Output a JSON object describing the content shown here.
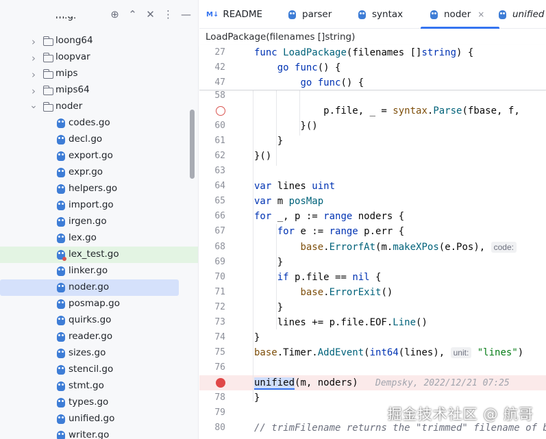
{
  "tree_toolbar": {
    "icons": [
      "crosshair-icon",
      "expand-icon",
      "collapse-icon",
      "more-vertical-icon",
      "hide-icon"
    ],
    "glyphs": [
      "⊕",
      "⌃",
      "✕",
      "⋮",
      "—"
    ]
  },
  "tree": {
    "truncated_top_label": "m.g.",
    "folders": [
      {
        "label": "loong64",
        "expanded": false
      },
      {
        "label": "loopvar",
        "expanded": false
      },
      {
        "label": "mips",
        "expanded": false
      },
      {
        "label": "mips64",
        "expanded": false
      },
      {
        "label": "noder",
        "expanded": true
      }
    ],
    "files": [
      {
        "label": "codes.go"
      },
      {
        "label": "decl.go"
      },
      {
        "label": "export.go"
      },
      {
        "label": "expr.go"
      },
      {
        "label": "helpers.go"
      },
      {
        "label": "import.go"
      },
      {
        "label": "irgen.go"
      },
      {
        "label": "lex.go"
      },
      {
        "label": "lex_test.go",
        "status": "added-green"
      },
      {
        "label": "linker.go"
      },
      {
        "label": "noder.go",
        "status": "selected"
      },
      {
        "label": "posmap.go"
      },
      {
        "label": "quirks.go"
      },
      {
        "label": "reader.go"
      },
      {
        "label": "sizes.go"
      },
      {
        "label": "stencil.go"
      },
      {
        "label": "stmt.go"
      },
      {
        "label": "types.go"
      },
      {
        "label": "unified.go"
      },
      {
        "label": "writer.go"
      }
    ]
  },
  "tabs": [
    {
      "label": "README",
      "icon": "markdown-icon",
      "badge": "M↓",
      "active": false,
      "italic": false
    },
    {
      "label": "parser",
      "icon": "go-file-icon",
      "active": false,
      "italic": false
    },
    {
      "label": "syntax",
      "icon": "go-file-icon",
      "active": false,
      "italic": false
    },
    {
      "label": "noder",
      "icon": "go-file-icon",
      "active": true,
      "italic": false,
      "close": "×"
    },
    {
      "label": "unified",
      "icon": "go-file-icon",
      "active": false,
      "italic": true
    }
  ],
  "breadcrumb": "LoadPackage(filenames []string)",
  "sticky_lines": [
    {
      "ln": "27",
      "tokens": [
        [
          "kw",
          "func "
        ],
        [
          "fn",
          "LoadPackage"
        ],
        [
          "",
          "("
        ],
        [
          "",
          "filenames "
        ],
        [
          "",
          "[]"
        ],
        [
          "ty",
          "string"
        ],
        [
          "",
          ") {"
        ]
      ]
    },
    {
      "ln": "42",
      "tokens": [
        [
          "",
          "    "
        ],
        [
          "kw",
          "go "
        ],
        [
          "kw",
          "func"
        ],
        [
          "",
          "() {"
        ]
      ]
    },
    {
      "ln": "47",
      "tokens": [
        [
          "",
          "        "
        ],
        [
          "kw",
          "go "
        ],
        [
          "kw",
          "func"
        ],
        [
          "",
          "() {"
        ]
      ]
    }
  ],
  "lines": [
    {
      "ln": "58",
      "tokens": []
    },
    {
      "ln": "",
      "breakpoint": "hollow",
      "tokens": [
        [
          "",
          "            p.file, _ = "
        ],
        [
          "pkg",
          "syntax"
        ],
        [
          "",
          "."
        ],
        [
          "call",
          "Parse"
        ],
        [
          "",
          "(fbase, f,"
        ]
      ]
    },
    {
      "ln": "60",
      "tokens": [
        [
          "",
          "        }()"
        ]
      ]
    },
    {
      "ln": "61",
      "tokens": [
        [
          "",
          "    }"
        ]
      ]
    },
    {
      "ln": "62",
      "tokens": [
        [
          "",
          "}()"
        ]
      ]
    },
    {
      "ln": "63",
      "tokens": []
    },
    {
      "ln": "64",
      "tokens": [
        [
          "kw",
          "var "
        ],
        [
          "",
          "lines "
        ],
        [
          "ty",
          "uint"
        ]
      ]
    },
    {
      "ln": "65",
      "tokens": [
        [
          "kw",
          "var "
        ],
        [
          "",
          "m "
        ],
        [
          "fn",
          "posMap"
        ]
      ]
    },
    {
      "ln": "66",
      "tokens": [
        [
          "kw",
          "for "
        ],
        [
          "",
          "_, p := "
        ],
        [
          "kw",
          "range "
        ],
        [
          "",
          "noders {"
        ]
      ]
    },
    {
      "ln": "67",
      "tokens": [
        [
          "",
          "    "
        ],
        [
          "kw",
          "for "
        ],
        [
          "",
          "e := "
        ],
        [
          "kw",
          "range "
        ],
        [
          "",
          "p.err {"
        ]
      ]
    },
    {
      "ln": "68",
      "tokens": [
        [
          "",
          "        "
        ],
        [
          "pkg",
          "base"
        ],
        [
          "",
          "."
        ],
        [
          "call",
          "ErrorfAt"
        ],
        [
          "",
          "(m."
        ],
        [
          "call",
          "makeXPos"
        ],
        [
          "",
          "(e.Pos), "
        ],
        [
          "lbl",
          "code:"
        ]
      ]
    },
    {
      "ln": "69",
      "tokens": [
        [
          "",
          "    }"
        ]
      ]
    },
    {
      "ln": "70",
      "tokens": [
        [
          "",
          "    "
        ],
        [
          "kw",
          "if "
        ],
        [
          "",
          "p.file == "
        ],
        [
          "kw",
          "nil "
        ],
        [
          "",
          "{"
        ]
      ]
    },
    {
      "ln": "71",
      "tokens": [
        [
          "",
          "        "
        ],
        [
          "pkg",
          "base"
        ],
        [
          "",
          "."
        ],
        [
          "call",
          "ErrorExit"
        ],
        [
          "",
          "()"
        ]
      ]
    },
    {
      "ln": "72",
      "tokens": [
        [
          "",
          "    }"
        ]
      ]
    },
    {
      "ln": "73",
      "tokens": [
        [
          "",
          "    lines += p.file.EOF."
        ],
        [
          "call",
          "Line"
        ],
        [
          "",
          "()"
        ]
      ]
    },
    {
      "ln": "74",
      "tokens": [
        [
          "",
          "}"
        ]
      ]
    },
    {
      "ln": "75",
      "tokens": [
        [
          "pkg",
          "base"
        ],
        [
          "",
          ".Timer."
        ],
        [
          "call",
          "AddEvent"
        ],
        [
          "",
          "("
        ],
        [
          "ty",
          "int64"
        ],
        [
          "",
          "(lines), "
        ],
        [
          "lbl",
          "unit:"
        ],
        [
          "",
          " "
        ],
        [
          "str",
          "\"lines\""
        ],
        [
          "",
          ")"
        ]
      ]
    },
    {
      "ln": "76",
      "tokens": []
    },
    {
      "ln": "",
      "breakpoint": "filled",
      "exec": true,
      "tokens": [
        [
          "hl",
          "unified"
        ],
        [
          "",
          "(m, noders)"
        ],
        [
          "",
          "   "
        ],
        [
          "blame",
          "Dempsky, 2022/12/21 07:25"
        ]
      ]
    },
    {
      "ln": "78",
      "tokens": [
        [
          "",
          "}"
        ]
      ]
    },
    {
      "ln": "79",
      "tokens": []
    },
    {
      "ln": "80",
      "tokens": [
        [
          "cmt",
          "// trimFilename returns the \"trimmed\" filename of b"
        ]
      ]
    }
  ],
  "watermark": "掘金技术社区 @ 航哥"
}
